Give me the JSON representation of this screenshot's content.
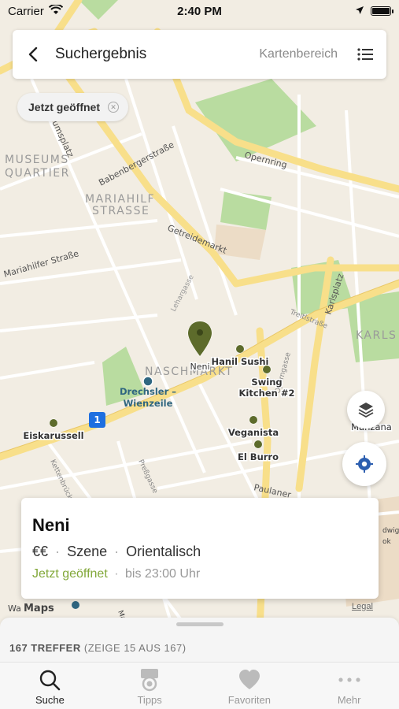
{
  "status_bar": {
    "carrier": "Carrier",
    "time": "2:40 PM"
  },
  "search_bar": {
    "title": "Suchergebnis",
    "area_label": "Kartenbereich"
  },
  "filter_chip": {
    "label": "Jetzt geöffnet"
  },
  "map": {
    "district_labels": [
      "MUSEUMS",
      "QUARTIER",
      "MARIAHILF",
      "STRASSE",
      "NASCHMARKT",
      "KARLS"
    ],
    "street_labels": [
      "Babenbergerstraße",
      "Opernring",
      "Getreidemarkt",
      "Mariahilfer Straße",
      "Lehargasse",
      "Treitlstraße",
      "Karlsplatz",
      "Operngasse",
      "Kettenbrück",
      "Preßgasse",
      "Paulaner",
      "umsplatz"
    ],
    "places": [
      {
        "name": "Neni",
        "selected": true
      },
      {
        "name": "Hanil Sushi"
      },
      {
        "name": "Swing\nKitchen #2"
      },
      {
        "name": "Veganista"
      },
      {
        "name": "El Burro"
      },
      {
        "name": "Eiskarussell"
      },
      {
        "name": "Manzana"
      }
    ],
    "transit": {
      "name": "Drechsler –\nWienzeile",
      "line_badge": "1"
    },
    "bottom_partial_labels": [
      "Wa",
      "Maps",
      "Marg",
      "dwig",
      "ok"
    ],
    "legal": "Legal",
    "colors": {
      "land": "#f2ede3",
      "park": "#b9dca0",
      "road_major": "#f8df8a",
      "road_minor": "#ffffff",
      "pin": "#5d6b2b",
      "transit": "#2f6680",
      "badge": "#1e6fe0"
    }
  },
  "result_card": {
    "name": "Neni",
    "price": "€€",
    "category": "Szene",
    "cuisine": "Orientalisch",
    "status": "Jetzt geöffnet",
    "hours": "bis 23:00 Uhr"
  },
  "sheet": {
    "count": "167 TREFFER",
    "showing": "(ZEIGE 15 AUS 167)"
  },
  "tabbar": {
    "tabs": [
      {
        "label": "Suche",
        "icon": "search-icon",
        "active": true
      },
      {
        "label": "Tipps",
        "icon": "medal-icon"
      },
      {
        "label": "Favoriten",
        "icon": "heart-icon"
      },
      {
        "label": "Mehr",
        "icon": "more-icon"
      }
    ]
  }
}
